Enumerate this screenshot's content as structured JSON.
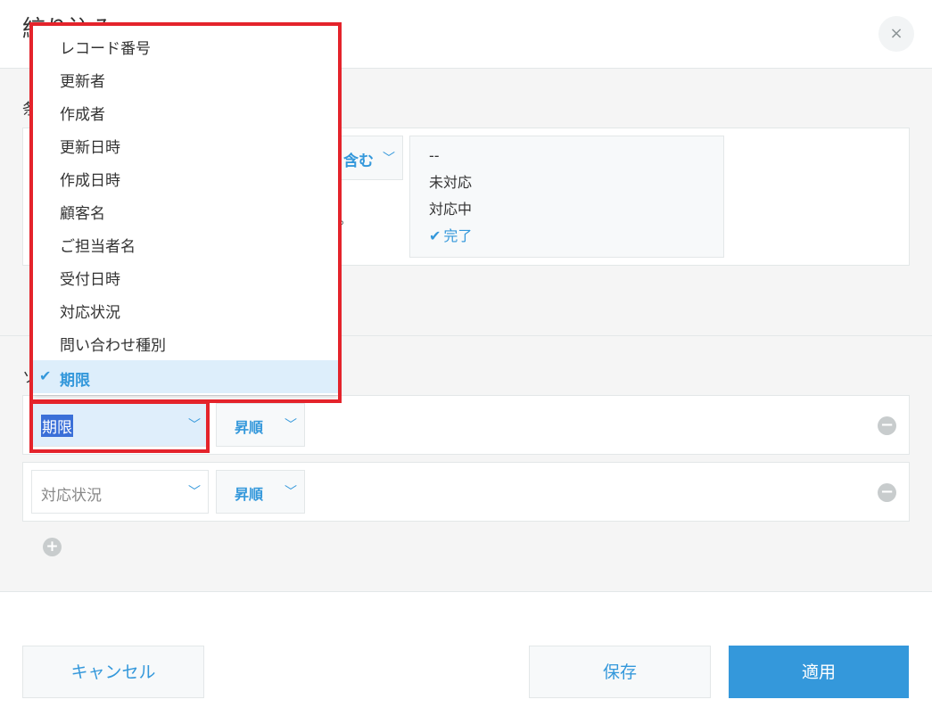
{
  "dialog": {
    "title": "絞り込み",
    "close_symbol": "×"
  },
  "conditions": {
    "label": "条件",
    "operator": "を含む",
    "operator_visible": "含む",
    "options": [
      {
        "label": "--",
        "selected": false
      },
      {
        "label": "未対応",
        "selected": false
      },
      {
        "label": "対応中",
        "selected": false
      },
      {
        "label": "完了",
        "selected": true
      }
    ]
  },
  "sort": {
    "label": "ソート",
    "rows": [
      {
        "field": "期限",
        "order": "昇順"
      },
      {
        "field": "対応状況",
        "order": "昇順"
      }
    ]
  },
  "dropdown": {
    "items": [
      {
        "label": "レコード番号",
        "selected": false
      },
      {
        "label": "更新者",
        "selected": false
      },
      {
        "label": "作成者",
        "selected": false
      },
      {
        "label": "更新日時",
        "selected": false
      },
      {
        "label": "作成日時",
        "selected": false
      },
      {
        "label": "顧客名",
        "selected": false
      },
      {
        "label": "ご担当者名",
        "selected": false
      },
      {
        "label": "受付日時",
        "selected": false
      },
      {
        "label": "対応状況",
        "selected": false
      },
      {
        "label": "問い合わせ種別",
        "selected": false
      },
      {
        "label": "期限",
        "selected": true
      }
    ]
  },
  "footer": {
    "cancel": "キャンセル",
    "save": "保存",
    "apply": "適用"
  },
  "icons": {
    "check": "check-icon",
    "chevron": "chevron-down-icon",
    "minus": "minus-circle-icon",
    "plus": "plus-circle-icon"
  },
  "colors": {
    "accent": "#3498db",
    "highlight": "#e4232b"
  }
}
